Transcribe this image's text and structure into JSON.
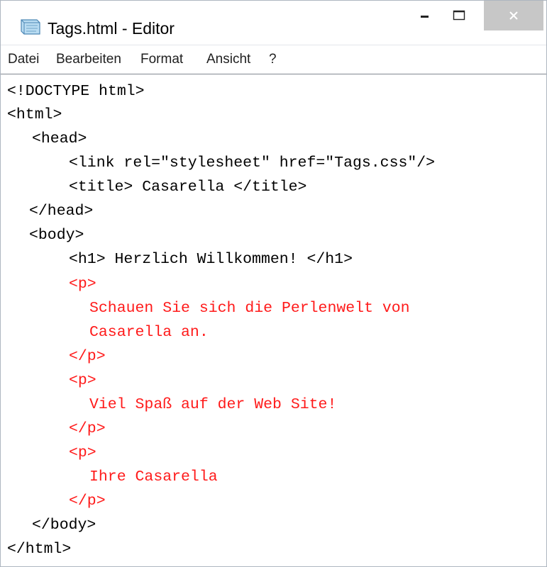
{
  "window": {
    "title": "Tags.html - Editor",
    "icons": {
      "app": "notepad-icon",
      "minimize": "minimize-icon",
      "maximize": "maximize-icon",
      "close": "close-icon"
    }
  },
  "menu": {
    "items": [
      "Datei",
      "Bearbeiten",
      "Format",
      "Ansicht",
      "?"
    ]
  },
  "editor": {
    "lines": [
      {
        "text": "<!DOCTYPE html>",
        "color": "#000000"
      },
      {
        "text": "<html>",
        "color": "#000000"
      },
      {
        "text": "<head>",
        "color": "#000000"
      },
      {
        "text": "<link rel=\"stylesheet\" href=\"Tags.css\"/>",
        "color": "#000000"
      },
      {
        "text": "<title> Casarella </title>",
        "color": "#000000"
      },
      {
        "text": "</head>",
        "color": "#000000"
      },
      {
        "text": "<body>",
        "color": "#000000"
      },
      {
        "text": "<h1> Herzlich Willkommen! </h1>",
        "color": "#000000"
      },
      {
        "text": "<p>",
        "color": "#ff1a1a"
      },
      {
        "text": "Schauen Sie sich die Perlenwelt von",
        "color": "#ff1a1a"
      },
      {
        "text": "Casarella an.",
        "color": "#ff1a1a"
      },
      {
        "text": "</p>",
        "color": "#ff1a1a"
      },
      {
        "text": "<p>",
        "color": "#ff1a1a"
      },
      {
        "text": "Viel Spaß auf der Web Site!",
        "color": "#ff1a1a"
      },
      {
        "text": "</p>",
        "color": "#ff1a1a"
      },
      {
        "text": "<p>",
        "color": "#ff1a1a"
      },
      {
        "text": "Ihre Casarella",
        "color": "#ff1a1a"
      },
      {
        "text": "</p>",
        "color": "#ff1a1a"
      },
      {
        "text": "</body>",
        "color": "#000000"
      },
      {
        "text": "</html>",
        "color": "#000000"
      }
    ]
  }
}
